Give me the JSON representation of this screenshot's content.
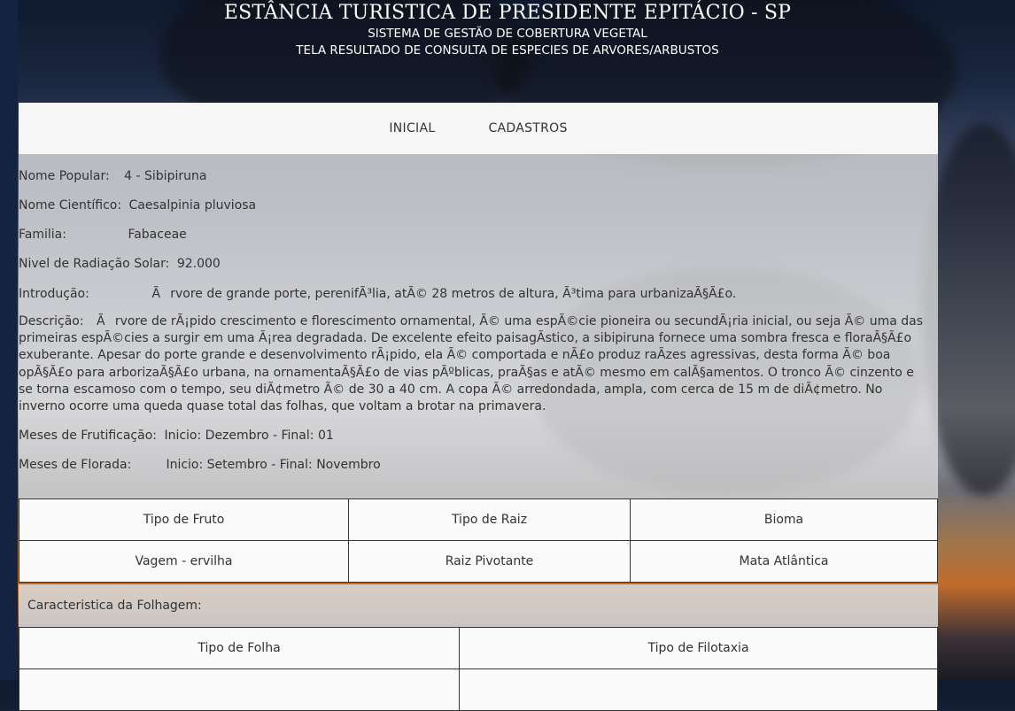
{
  "header": {
    "title": "ESTÂNCIA TURISTICA DE PRESIDENTE EPITÁCIO - SP",
    "subtitle": "SISTEMA DE GESTÃO DE COBERTURA VEGETAL",
    "screen": "TELA RESULTADO DE CONSULTA DE ESPECIES DE ARVORES/ARBUSTOS"
  },
  "nav": {
    "inicial": "INICIAL",
    "cadastros": "CADASTROS"
  },
  "species": {
    "nome_popular_label": "Nome Popular:",
    "nome_popular_value": "4 - Sibipiruna",
    "nome_cientifico_label": "Nome Científico:",
    "nome_cientifico_value": "Caesalpinia pluviosa",
    "familia_label": "Familia:",
    "familia_value": "Fabaceae",
    "radiacao_label": "Nivel de Radiação Solar:",
    "radiacao_value": "92.000",
    "introducao_label": "Introdução:",
    "introducao_value": "Ãrvore de grande porte, perenifÃ³lia, atÃ© 28 metros de altura, Ã³tima para urbanizaÃ§Ã£o.",
    "descricao_label": "Descrição:",
    "descricao_value": "Ãrvore de rÃ¡pido crescimento e florescimento ornamental, Ã© uma espÃ©cie pioneira ou secundÃ¡ria inicial, ou seja Ã© uma das primeiras espÃ©cies a surgir em uma Ã¡rea degradada. De excelente efeito paisagÃ­stico, a sibipiruna fornece uma sombra fresca e floraÃ§Ã£o exuberante. Apesar do porte grande e desenvolvimento rÃ¡pido, ela Ã© comportada e nÃ£o produz raÃ­zes agressivas, desta forma Ã© boa opÃ§Ã£o para arborizaÃ§Ã£o urbana, na ornamentaÃ§Ã£o de vias pÃºblicas, praÃ§as e atÃ© mesmo em calÃ§amentos. O tronco Ã© cinzento e se torna escamoso com o tempo, seu diÃ¢metro Ã© de 30 a 40 cm. A copa Ã© arredondada, ampla, com cerca de 15 m de diÃ¢metro. No inverno ocorre uma queda quase total das folhas, que voltam a brotar na primavera.",
    "frutificacao_label": "Meses de Frutificação:",
    "frutificacao_value": "Inicio: Dezembro  -  Final: 01",
    "florada_label": "Meses de Florada:",
    "florada_value": "Inicio: Setembro  -  Final: Novembro"
  },
  "table1": {
    "headers": [
      "Tipo de Fruto",
      "Tipo de Raiz",
      "Bioma"
    ],
    "values": [
      "Vagem - ervilha",
      "Raiz Pivotante",
      "Mata Atlântica"
    ]
  },
  "folhagem": {
    "label": "Caracteristica da Folhagem:",
    "headers": [
      "Tipo de Folha",
      "Tipo de Filotaxia"
    ]
  }
}
